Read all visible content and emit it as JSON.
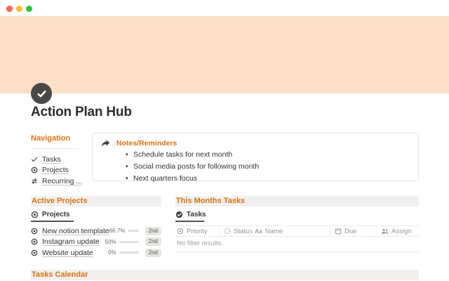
{
  "window": {
    "traffic_lights": [
      "#fe5f57",
      "#febb2e",
      "#28c73f"
    ]
  },
  "colors": {
    "banner": "#fbdfc6",
    "accent_orange": "#d9730d",
    "icon_dark": "#4a4947"
  },
  "page": {
    "title": "Action Plan Hub",
    "icon": "check-circle-icon"
  },
  "navigation": {
    "heading": "Navigation",
    "items": [
      {
        "icon": "check-icon",
        "label": "Tasks"
      },
      {
        "icon": "target-icon",
        "label": "Projects"
      },
      {
        "icon": "repeat-icon",
        "label": "Recurring ..."
      }
    ]
  },
  "callout": {
    "icon": "forward-arrow-icon",
    "title": "Notes/Reminders",
    "bullets": [
      "Schedule tasks for next month",
      "Social media posts for following month",
      "Next quarters focus"
    ]
  },
  "active_projects": {
    "heading": "Active Projects",
    "tab_label": "Projects",
    "rows": [
      {
        "name": "New notion template",
        "percent_label": "66.7%",
        "percent": 66.7,
        "badge": "2nd"
      },
      {
        "name": "Instagram update",
        "percent_label": "50%",
        "percent": 50,
        "badge": "2nd"
      },
      {
        "name": "Website update",
        "percent_label": "0%",
        "percent": 0,
        "badge": "2nd"
      }
    ]
  },
  "months_tasks": {
    "heading": "This Months Tasks",
    "tab_label": "Tasks",
    "columns": [
      {
        "icon": "priority-icon",
        "label": "Priority"
      },
      {
        "icon": "status-icon",
        "label": "Status"
      },
      {
        "icon": "text-icon",
        "label": "Name"
      },
      {
        "icon": "calendar-icon",
        "label": "Due"
      },
      {
        "icon": "people-icon",
        "label": "Assign"
      }
    ],
    "empty_text": "No filter results."
  },
  "tasks_calendar": {
    "heading": "Tasks Calendar"
  }
}
